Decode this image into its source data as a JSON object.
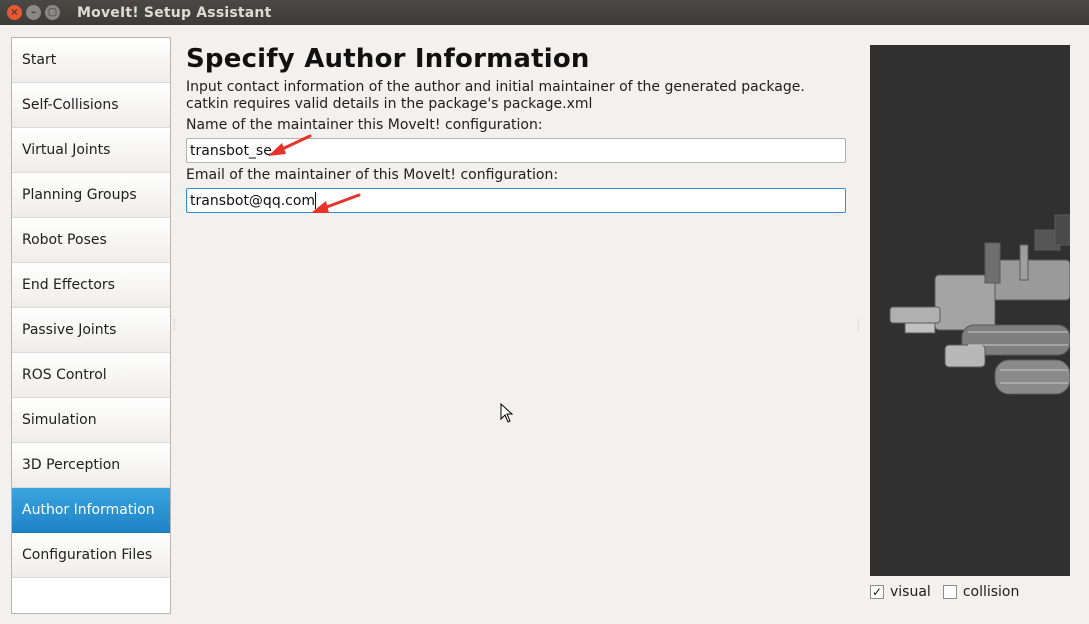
{
  "window": {
    "title": "MoveIt! Setup Assistant"
  },
  "sidebar": {
    "items": [
      {
        "label": "Start"
      },
      {
        "label": "Self-Collisions"
      },
      {
        "label": "Virtual Joints"
      },
      {
        "label": "Planning Groups"
      },
      {
        "label": "Robot Poses"
      },
      {
        "label": "End Effectors"
      },
      {
        "label": "Passive Joints"
      },
      {
        "label": "ROS Control"
      },
      {
        "label": "Simulation"
      },
      {
        "label": "3D Perception"
      },
      {
        "label": "Author Information"
      },
      {
        "label": "Configuration Files"
      }
    ],
    "active_index": 10
  },
  "main": {
    "heading": "Specify Author Information",
    "description": "Input contact information of the author and initial maintainer of the generated package. catkin requires valid details in the package's package.xml",
    "name_label": "Name of the maintainer this MoveIt! configuration:",
    "name_value": "transbot_se",
    "email_label": "Email of the maintainer of this MoveIt! configuration:",
    "email_value": "transbot@qq.com"
  },
  "viewer": {
    "visual_label": "visual",
    "visual_checked": true,
    "collision_label": "collision",
    "collision_checked": false
  },
  "colors": {
    "active_item": "#2a91d3",
    "annotation_arrow": "#e8332c",
    "viewer_bg": "#303030"
  }
}
